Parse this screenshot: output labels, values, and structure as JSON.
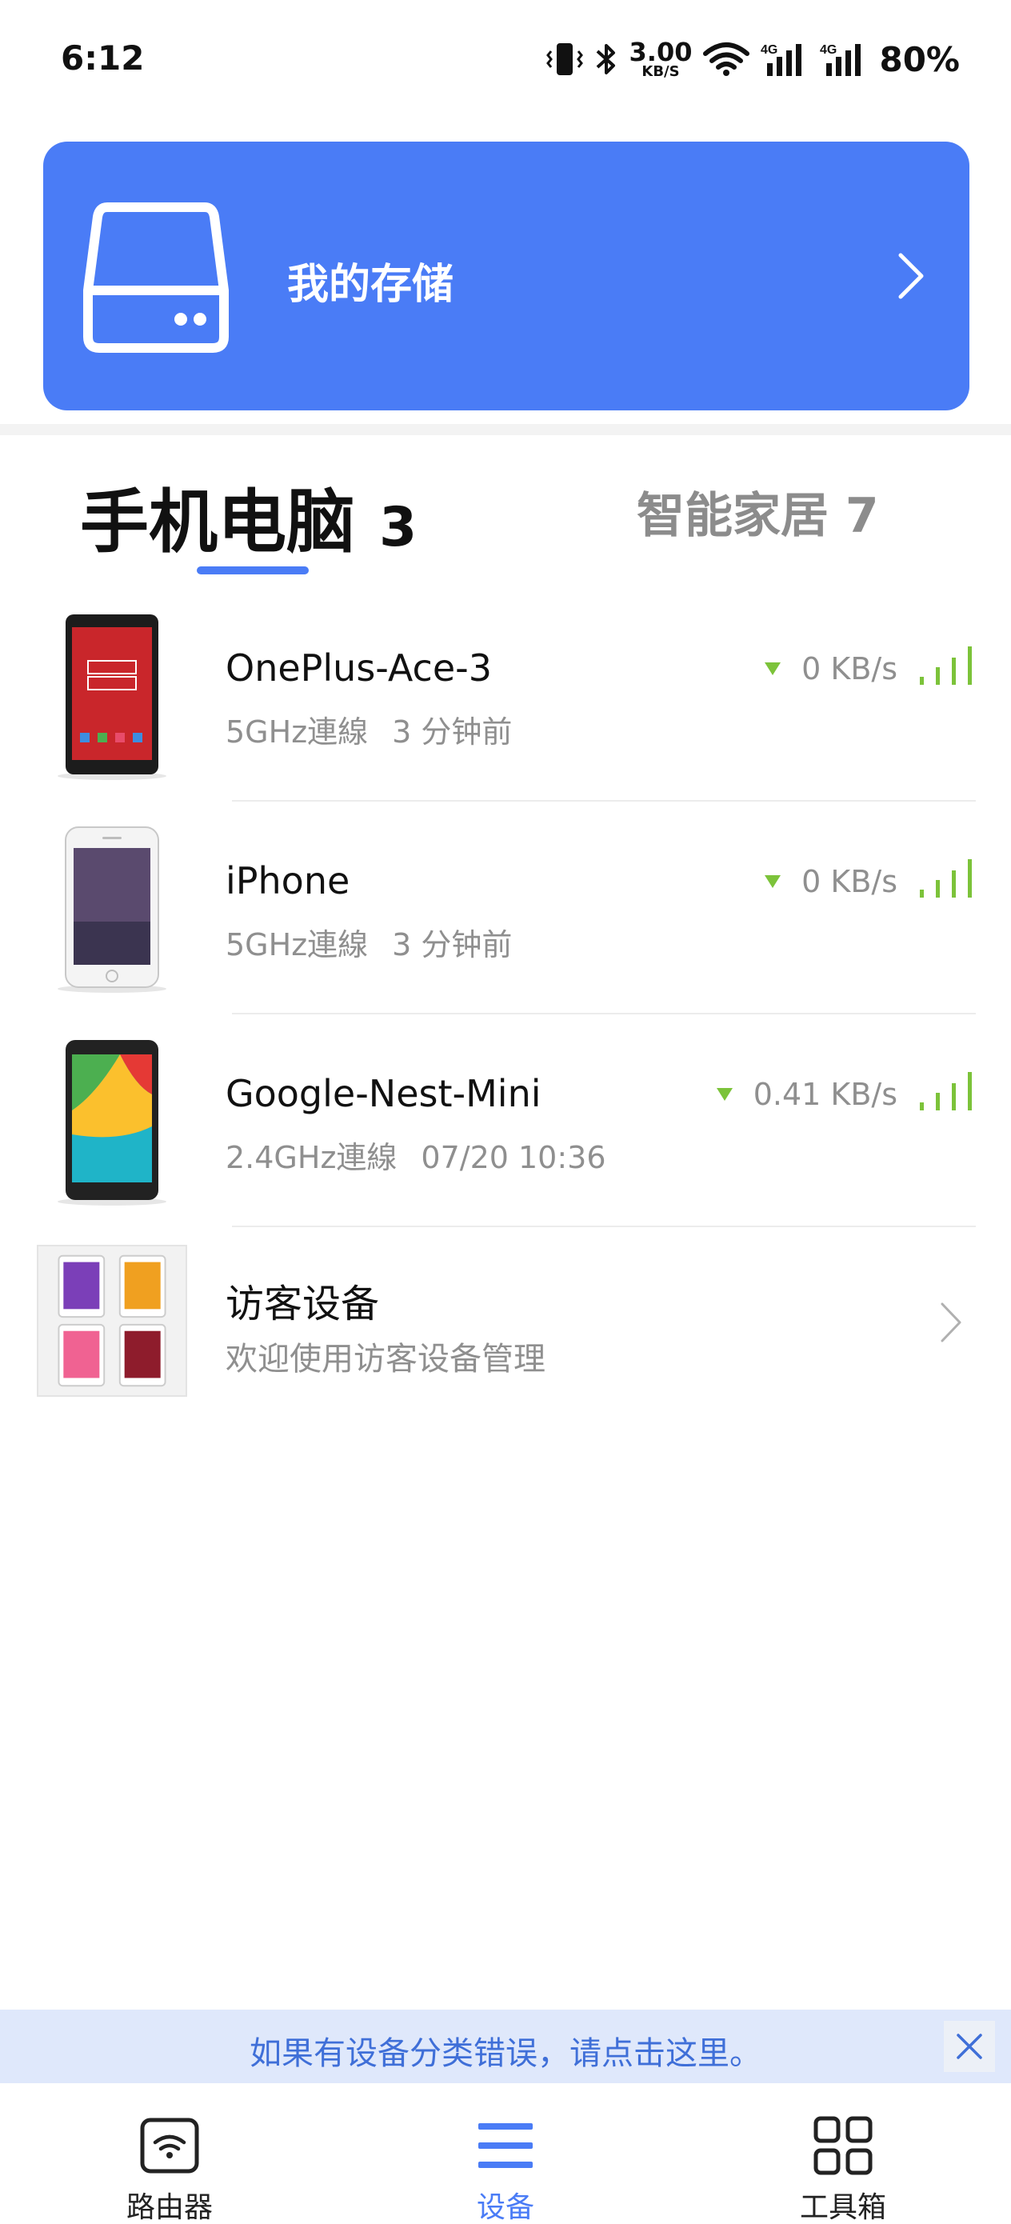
{
  "status_bar": {
    "time": "6:12",
    "net_speed_value": "3.00",
    "net_speed_unit": "KB/S",
    "network_label_1": "4G",
    "network_label_2": "4G",
    "battery": "80%"
  },
  "storage": {
    "label": "我的存储"
  },
  "tabs": [
    {
      "label": "手机电脑",
      "count": "3",
      "active": true
    },
    {
      "label": "智能家居",
      "count": "7",
      "active": false
    }
  ],
  "devices": [
    {
      "name": "OnePlus-Ace-3",
      "connection": "5GHz連線",
      "time": "3 分钟前",
      "speed": "0 KB/s",
      "thumb": "android-phone-red"
    },
    {
      "name": "iPhone",
      "connection": "5GHz連線",
      "time": "3 分钟前",
      "speed": "0 KB/s",
      "thumb": "iphone-white"
    },
    {
      "name": "Google-Nest-Mini",
      "connection": "2.4GHz連線",
      "time": "07/20 10:36",
      "speed": "0.41 KB/s",
      "thumb": "android-phone-colorful"
    }
  ],
  "guest": {
    "title": "访客设备",
    "subtitle": "欢迎使用访客设备管理"
  },
  "tip": {
    "text": "如果有设备分类错误，请点击这里。"
  },
  "nav": [
    {
      "label": "路由器",
      "icon": "router-icon",
      "active": false
    },
    {
      "label": "设备",
      "icon": "list-icon",
      "active": true
    },
    {
      "label": "工具箱",
      "icon": "grid-icon",
      "active": false
    }
  ],
  "colors": {
    "accent": "#4a7cf6",
    "signal_green": "#7cc33a",
    "tip_background": "#dfe8fb"
  }
}
